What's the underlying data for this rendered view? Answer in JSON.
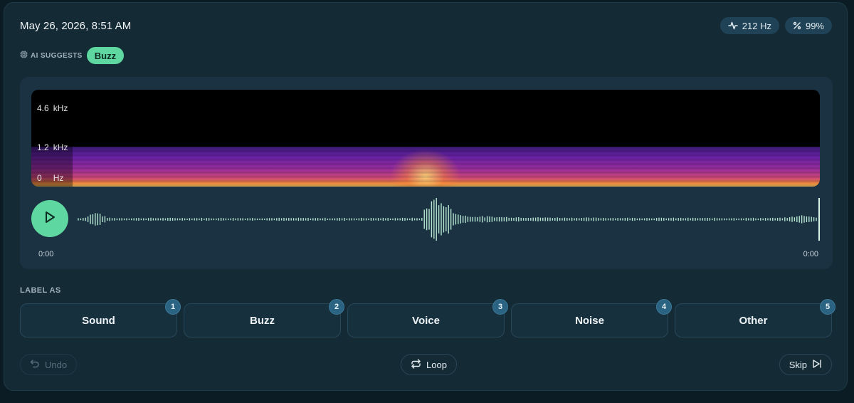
{
  "header": {
    "datetime": "May 26, 2026, 8:51 AM",
    "frequency_pill": "212 Hz",
    "confidence_pill": "99%"
  },
  "ai": {
    "label": "AI SUGGESTS",
    "suggestion": "Buzz"
  },
  "spectrogram": {
    "freq_labels": [
      {
        "value": "4.6",
        "unit": "kHz"
      },
      {
        "value": "1.2",
        "unit": "kHz"
      },
      {
        "value": "0",
        "unit": "Hz"
      }
    ]
  },
  "player": {
    "time_start": "0:00",
    "time_end": "0:00"
  },
  "labeling": {
    "heading": "LABEL AS",
    "options": [
      {
        "label": "Sound",
        "key": "1"
      },
      {
        "label": "Buzz",
        "key": "2"
      },
      {
        "label": "Voice",
        "key": "3"
      },
      {
        "label": "Noise",
        "key": "4"
      },
      {
        "label": "Other",
        "key": "5"
      }
    ]
  },
  "actions": {
    "undo": "Undo",
    "loop": "Loop",
    "skip": "Skip"
  },
  "colors": {
    "accent": "#5fd7a0",
    "background": "#0c1c24",
    "card": "#142a35",
    "pill": "#1f4257"
  },
  "icons": {
    "frequency": "activity-icon",
    "confidence": "percent-icon",
    "ai": "chip-icon",
    "play": "play-icon",
    "undo": "undo-icon",
    "loop": "loop-icon",
    "skip": "skip-icon"
  }
}
